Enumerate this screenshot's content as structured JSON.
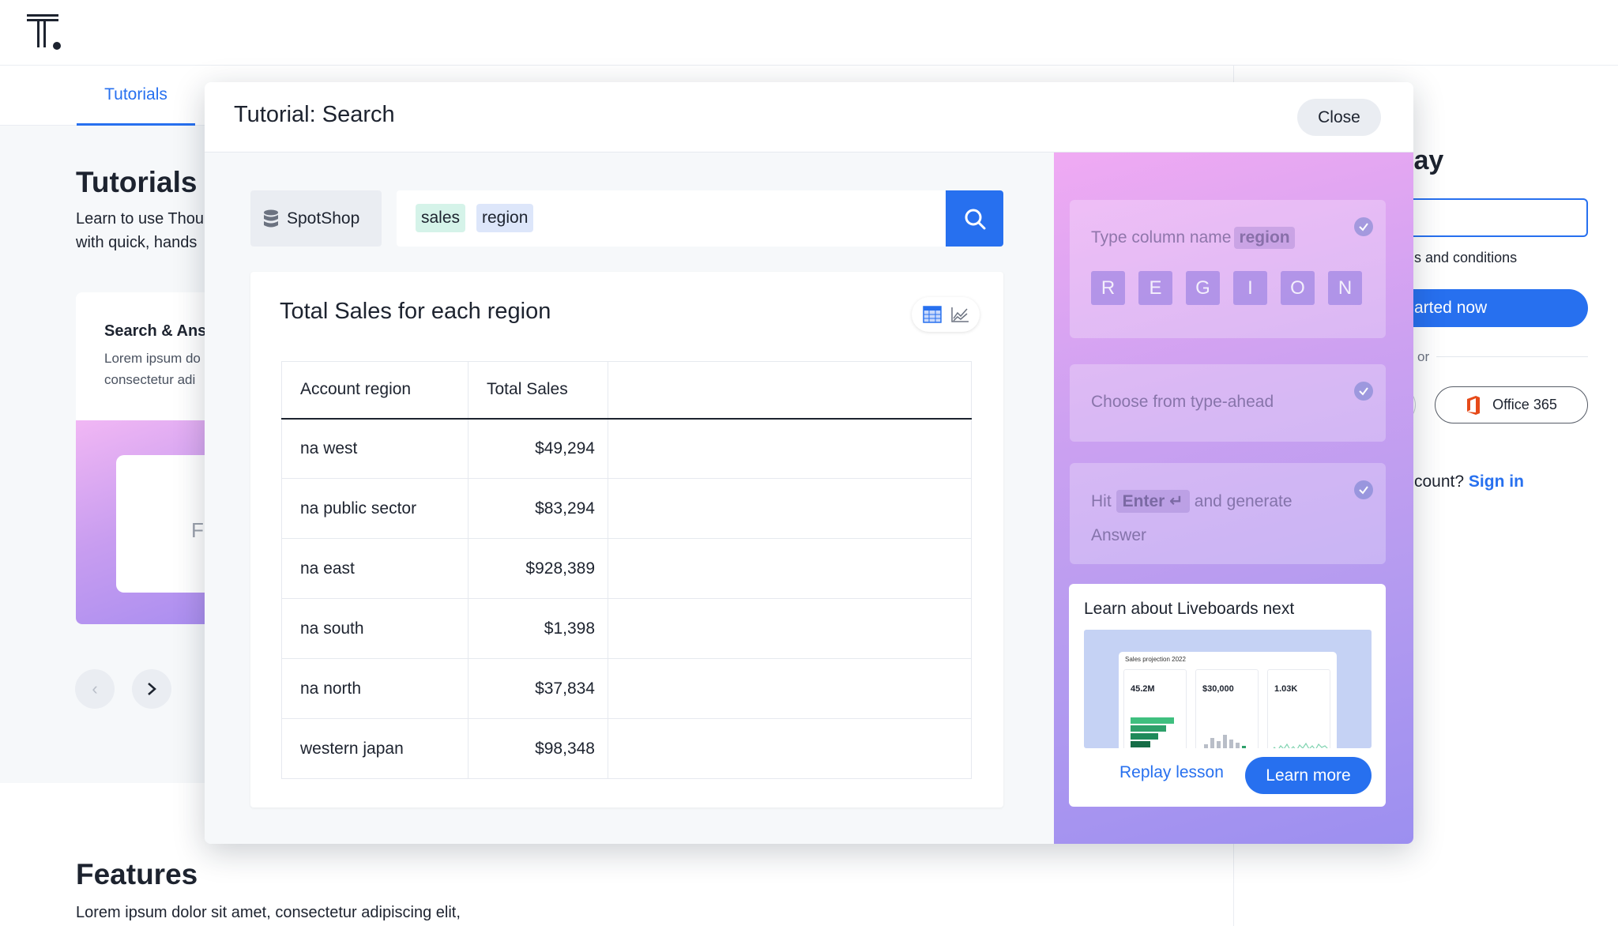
{
  "background": {
    "tab_active": "Tutorials",
    "title": "Tutorials",
    "desc_line1": "Learn to use Thou",
    "desc_line2": "with quick, hands",
    "card": {
      "title": "Search & Ans",
      "desc_line1": "Lorem ipsum do",
      "desc_line2": "consectetur adi",
      "inner_text": "F"
    },
    "features_title": "Features",
    "features_desc": "Lorem ipsum dolor sit amet, consectetur adipiscing elit,",
    "right": {
      "title": "lay",
      "terms": "s and conditions",
      "cta": "arted now",
      "or": "or",
      "office": "Office 365",
      "signin_prefix": "count?",
      "signin_link": "Sign in"
    }
  },
  "modal": {
    "title": "Tutorial: Search",
    "close_label": "Close",
    "source": "SpotShop",
    "tokens": [
      "sales",
      "region"
    ],
    "answer": {
      "title": "Total Sales for each region",
      "columns": [
        "Account region",
        "Total Sales",
        ""
      ],
      "rows": [
        {
          "region": "na west",
          "sales": "$49,294"
        },
        {
          "region": "na public sector",
          "sales": "$83,294"
        },
        {
          "region": "na east",
          "sales": "$928,389"
        },
        {
          "region": "na south",
          "sales": "$1,398"
        },
        {
          "region": "na north",
          "sales": "$37,834"
        },
        {
          "region": "western japan",
          "sales": "$98,348"
        }
      ]
    },
    "steps": {
      "step1_text": "Type column name",
      "step1_pill": "region",
      "letters": [
        "R",
        "E",
        "G",
        "I",
        "O",
        "N"
      ],
      "step2_text": "Choose from type-ahead",
      "step3_hit": "Hit",
      "step3_key": "Enter ↵",
      "step3_after": "and generate",
      "step3_line2": "Answer"
    },
    "next": {
      "title": "Learn about Liveboards next",
      "preview_title": "Sales projection 2022",
      "preview_nums": [
        "45.2M",
        "$30,000",
        "1.03K"
      ],
      "replay_label": "Replay lesson",
      "learn_label": "Learn more"
    }
  },
  "colors": {
    "accent": "#2770ef",
    "token_sales_bg": "#d5f3e9",
    "token_region_bg": "#dde6fa",
    "office_red": "#e64a19"
  }
}
